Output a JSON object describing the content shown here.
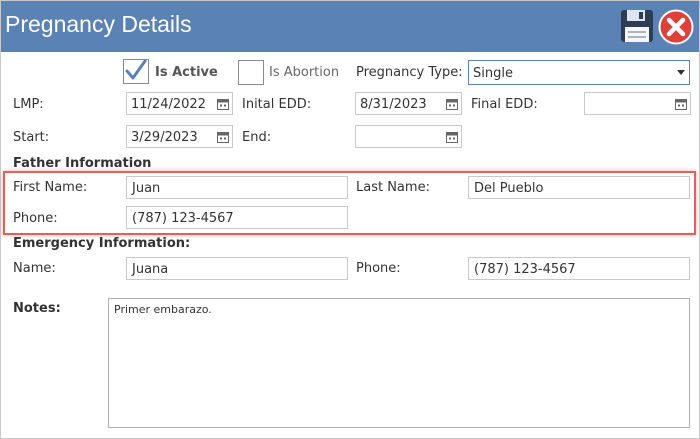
{
  "window": {
    "title": "Pregnancy Details"
  },
  "toolbar": {
    "save_icon": "floppy-disk-icon",
    "close_icon": "close-circle-icon",
    "close_color": "#e0403a",
    "accent": "#5b82b5"
  },
  "status": {
    "is_active_label": "Is Active",
    "is_active_checked": true,
    "is_abortion_label": "Is Abortion",
    "is_abortion_checked": false,
    "pregnancy_type_label": "Pregnancy Type:",
    "pregnancy_type_value": "Single"
  },
  "dates": {
    "lmp_label": "LMP:",
    "lmp_value": "11/24/2022",
    "initial_edd_label": "Inital EDD:",
    "initial_edd_value": "8/31/2023",
    "final_edd_label": "Final EDD:",
    "final_edd_value": "",
    "start_label": "Start:",
    "start_value": "3/29/2023",
    "end_label": "End:",
    "end_value": ""
  },
  "father": {
    "heading": "Father Information",
    "first_name_label": "First Name:",
    "first_name_value": "Juan",
    "last_name_label": "Last Name:",
    "last_name_value": "Del Pueblo",
    "phone_label": "Phone:",
    "phone_value": "(787) 123-4567"
  },
  "emergency": {
    "heading": "Emergency Information:",
    "name_label": "Name:",
    "name_value": "Juana",
    "phone_label": "Phone:",
    "phone_value": "(787) 123-4567"
  },
  "notes": {
    "label": "Notes:",
    "value": "Primer embarazo."
  }
}
